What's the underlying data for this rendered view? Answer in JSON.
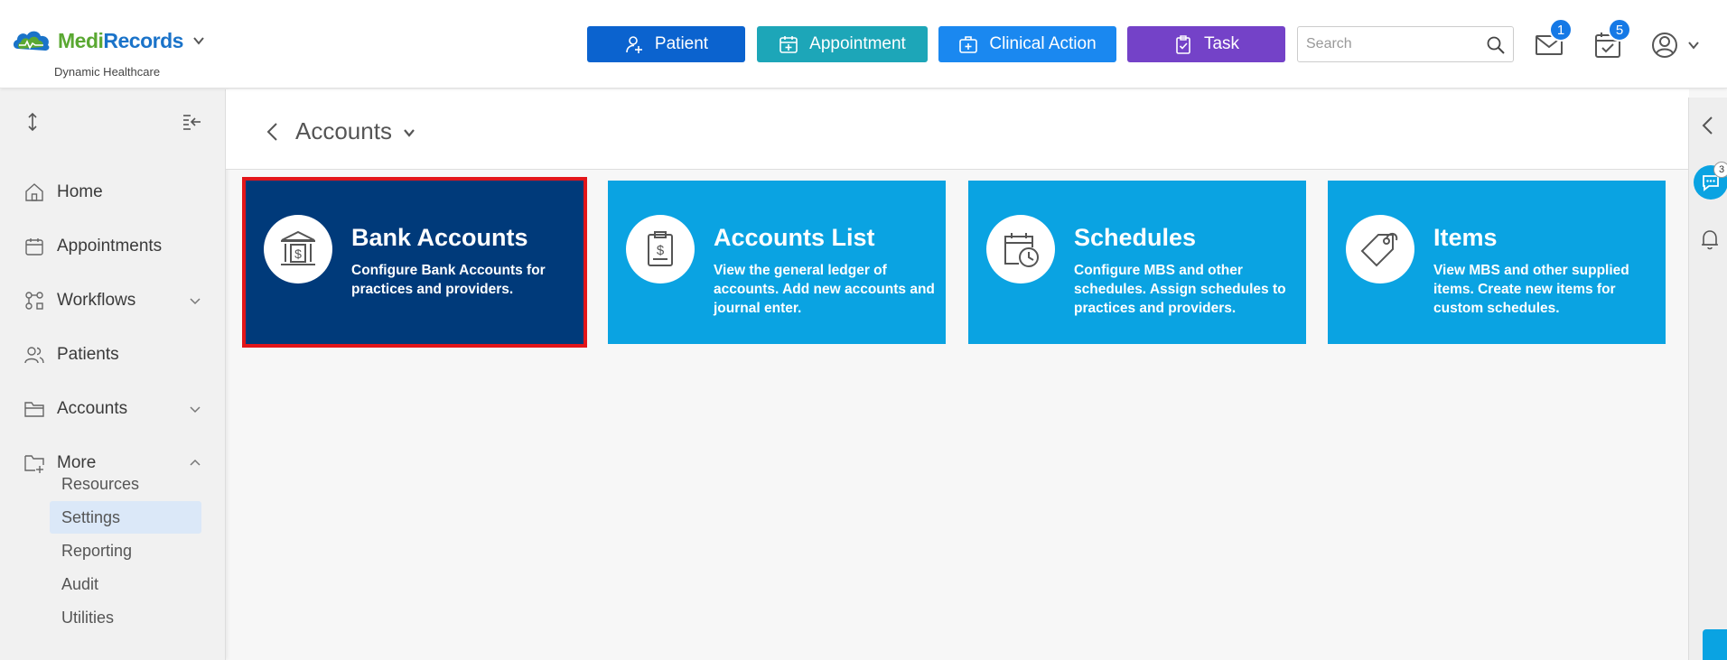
{
  "app": {
    "brand_part1": "Medi",
    "brand_part2": "Records",
    "org_name": "Dynamic Healthcare"
  },
  "header": {
    "buttons": [
      {
        "label": "Patient",
        "icon": "add-user-icon",
        "color": "#0b63cf"
      },
      {
        "label": "Appointment",
        "icon": "calendar-plus-icon",
        "color": "#1da6b8"
      },
      {
        "label": "Clinical Action",
        "icon": "medical-kit-icon",
        "color": "#1a88f0"
      },
      {
        "label": "Task",
        "icon": "clipboard-check-icon",
        "color": "#7442c8"
      }
    ],
    "search": {
      "placeholder": "Search",
      "value": ""
    },
    "mail_count": "1",
    "tasks_count": "5"
  },
  "sidebar": {
    "items": [
      {
        "label": "Home",
        "icon": "home-icon"
      },
      {
        "label": "Appointments",
        "icon": "calendar-icon"
      },
      {
        "label": "Workflows",
        "icon": "workflow-icon",
        "expandable": true
      },
      {
        "label": "Patients",
        "icon": "users-icon"
      },
      {
        "label": "Accounts",
        "icon": "folder-icon",
        "expandable": true
      },
      {
        "label": "More",
        "icon": "folder-plus-icon",
        "expanded": true
      }
    ],
    "more_sub": [
      {
        "label": "Resources"
      },
      {
        "label": "Settings",
        "active": true
      },
      {
        "label": "Reporting"
      },
      {
        "label": "Audit"
      },
      {
        "label": "Utilities"
      }
    ]
  },
  "page": {
    "title": "Accounts"
  },
  "tiles": [
    {
      "title": "Bank Accounts",
      "desc": "Configure Bank Accounts for practices and providers.",
      "icon": "bank-icon",
      "selected": true
    },
    {
      "title": "Accounts List",
      "desc": "View the general ledger of accounts. Add new accounts and journal enter.",
      "icon": "ledger-icon"
    },
    {
      "title": "Schedules",
      "desc": "Configure MBS and other schedules. Assign schedules to practices and providers.",
      "icon": "calendar-clock-icon"
    },
    {
      "title": "Items",
      "desc": "View MBS and other supplied items. Create new items for custom schedules.",
      "icon": "tag-icon"
    }
  ],
  "right_rail": {
    "chat_count": "3"
  },
  "colors": {
    "tile_blue": "#0aa3e2",
    "tile_selected": "#003a7a",
    "selection_outline": "#e2151a",
    "brand_green": "#5aa832",
    "brand_blue": "#1a73c9"
  }
}
